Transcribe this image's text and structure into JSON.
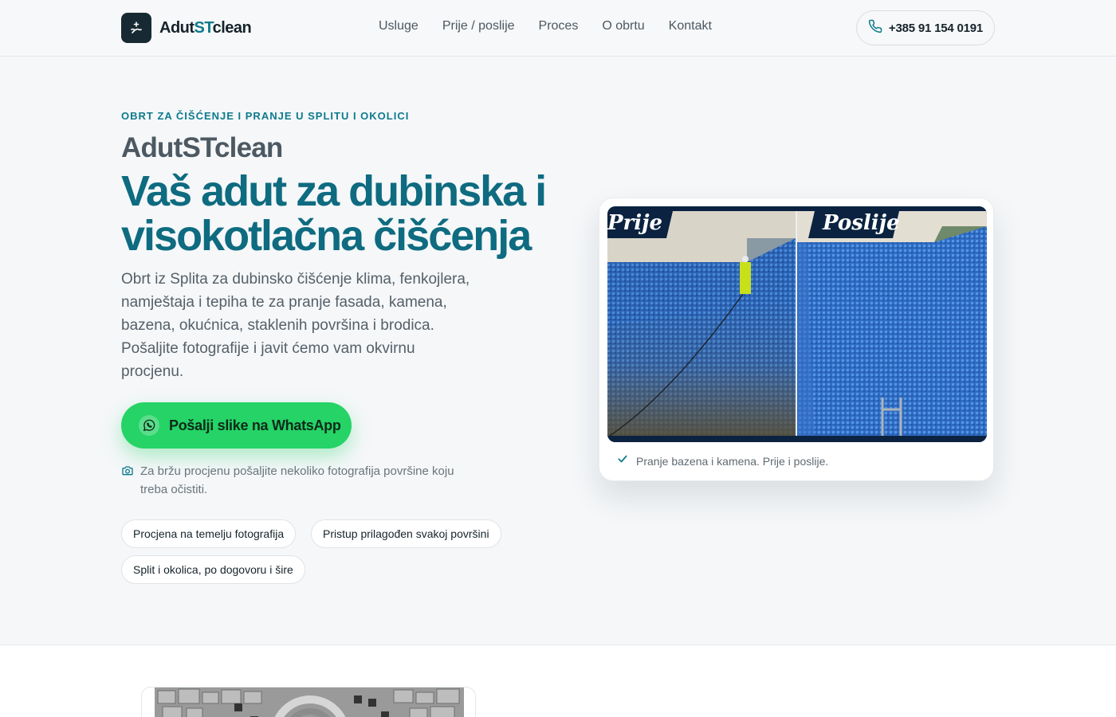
{
  "header": {
    "logo_prefix": "Adut",
    "logo_accent": "ST",
    "logo_suffix": "clean",
    "nav": [
      "Usluge",
      "Prije / poslije",
      "Proces",
      "O obrtu",
      "Kontakt"
    ],
    "phone": "+385 91 154 0191"
  },
  "hero": {
    "eyebrow": "OBRT ZA ČIŠĆENJE I PRANJE U SPLITU I OKOLICI",
    "brand": "AdutSTclean",
    "headline": "Vaš adut za dubinska i visokotlačna čišćenja",
    "lead": "Obrt iz Splita za dubinsko čišćenje klima, fenkojlera, namještaja i tepiha te za pranje fasada, kamena, bazena, okućnica, staklenih površina i brodica. Pošaljite fotografije i javit ćemo vam okvirnu procjenu.",
    "cta": "Pošalji slike na WhatsApp",
    "hint": "Za bržu procjenu pošaljite nekoliko fotografija površine koju treba očistiti.",
    "chips": [
      "Procjena na temelju fotografija",
      "Pristup prilagođen svakoj površini",
      "Split i okolica, po dogovoru i šire"
    ]
  },
  "showcase": {
    "before_label": "Prije",
    "after_label": "Poslije",
    "caption": "Pranje bazena i kamena. Prije i poslije."
  },
  "colors": {
    "accent": "#0e7a8c",
    "whatsapp": "#25d366",
    "dark": "#172a33"
  }
}
